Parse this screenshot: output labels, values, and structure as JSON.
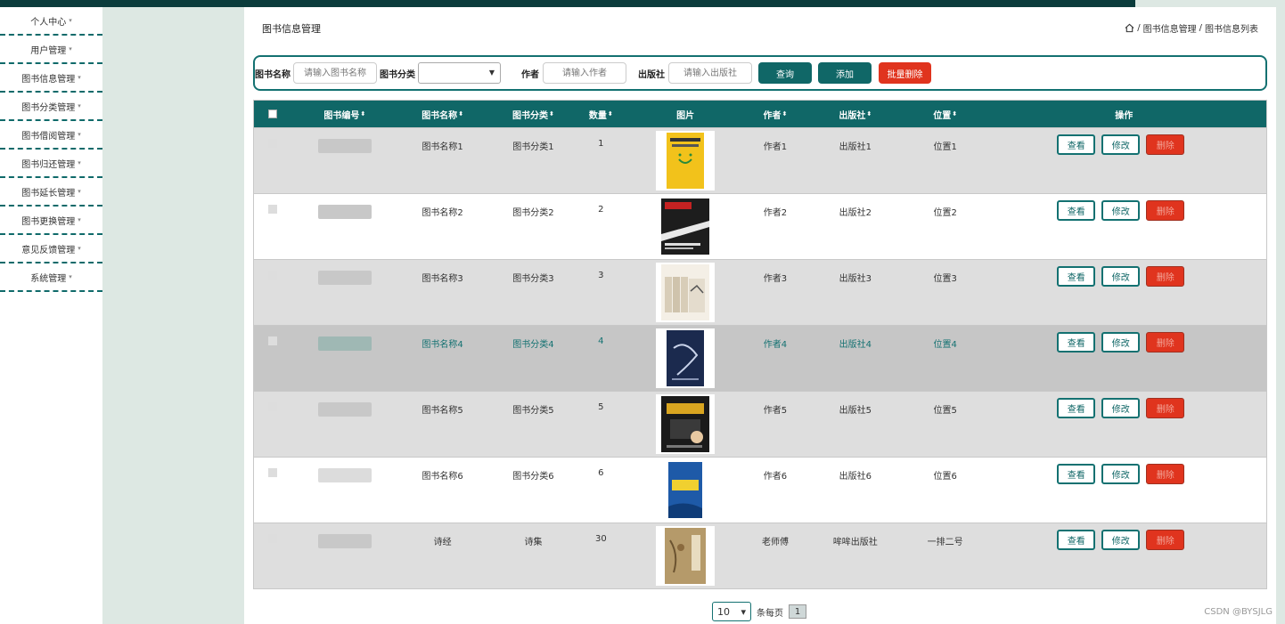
{
  "sidebar": {
    "items": [
      {
        "label": "个人中心"
      },
      {
        "label": "用户管理"
      },
      {
        "label": "图书信息管理"
      },
      {
        "label": "图书分类管理"
      },
      {
        "label": "图书借阅管理"
      },
      {
        "label": "图书归还管理"
      },
      {
        "label": "图书延长管理"
      },
      {
        "label": "图书更换管理"
      },
      {
        "label": "意见反馈管理"
      },
      {
        "label": "系统管理"
      }
    ],
    "caret": "▾"
  },
  "header": {
    "title": "图书信息管理",
    "breadcrumb": {
      "sep1": "/",
      "item1": "图书信息管理",
      "sep2": "/",
      "item2": "图书信息列表"
    }
  },
  "search": {
    "name_label": "图书名称",
    "name_placeholder": "请输入图书名称",
    "category_label": "图书分类",
    "category_value": "",
    "author_label": "作者",
    "author_placeholder": "请输入作者",
    "publisher_label": "出版社",
    "publisher_placeholder": "请输入出版社",
    "query_label": "查询",
    "add_label": "添加",
    "batch_delete_label": "批量删除",
    "arrow": "▼"
  },
  "table": {
    "headers": {
      "number": "图书编号",
      "name": "图书名称",
      "category": "图书分类",
      "quantity": "数量",
      "image": "图片",
      "author": "作者",
      "publisher": "出版社",
      "position": "位置",
      "ops": "操作",
      "sort_icon": "⬍"
    },
    "ops": {
      "view": "查看",
      "edit": "修改",
      "delete": "删除"
    },
    "rows": [
      {
        "name": "图书名称1",
        "category": "图书分类1",
        "quantity": "1",
        "author": "作者1",
        "publisher": "出版社1",
        "position": "位置1"
      },
      {
        "name": "图书名称2",
        "category": "图书分类2",
        "quantity": "2",
        "author": "作者2",
        "publisher": "出版社2",
        "position": "位置2"
      },
      {
        "name": "图书名称3",
        "category": "图书分类3",
        "quantity": "3",
        "author": "作者3",
        "publisher": "出版社3",
        "position": "位置3"
      },
      {
        "name": "图书名称4",
        "category": "图书分类4",
        "quantity": "4",
        "author": "作者4",
        "publisher": "出版社4",
        "position": "位置4"
      },
      {
        "name": "图书名称5",
        "category": "图书分类5",
        "quantity": "5",
        "author": "作者5",
        "publisher": "出版社5",
        "position": "位置5"
      },
      {
        "name": "图书名称6",
        "category": "图书分类6",
        "quantity": "6",
        "author": "作者6",
        "publisher": "出版社6",
        "position": "位置6"
      },
      {
        "name": "诗经",
        "category": "诗集",
        "quantity": "30",
        "author": "老师傅",
        "publisher": "哞哞出版社",
        "position": "一排二号"
      }
    ]
  },
  "pagination": {
    "page_size": "10",
    "arrow": "▾",
    "per_page_label": "条每页",
    "current_page": "1"
  },
  "watermark": "CSDN @BYSJLG",
  "colors": {
    "primary": "#106767",
    "danger": "#e0341e"
  }
}
